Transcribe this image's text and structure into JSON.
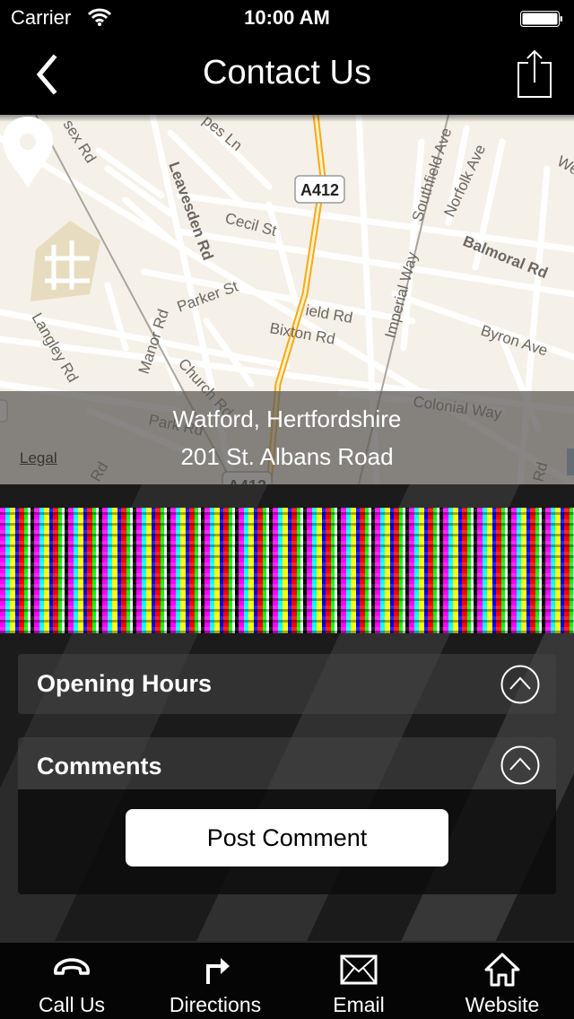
{
  "status_bar": {
    "carrier": "Carrier",
    "time": "10:00 AM"
  },
  "nav": {
    "title": "Contact Us",
    "back_icon": "chevron-left-icon",
    "share_icon": "share-icon"
  },
  "map": {
    "address_line1": "Watford, Hertfordshire",
    "address_line2": "201 St. Albans Road",
    "legal_label": "Legal",
    "road_shield": "A412",
    "street_labels": [
      "sex Rd",
      "pes Ln",
      "Leavesden Rd",
      "Cecil St",
      "Parker St",
      "Southfield Ave",
      "Norfolk Ave",
      "Balmoral Rd",
      "We",
      "Imperial Way",
      "Byron Ave",
      "ield Rd",
      "Bixton Rd",
      "Langley Rd",
      "Manor Rd",
      "Church Rd",
      "Park Rd",
      "Colonial Way",
      "Rd",
      "Rd"
    ]
  },
  "carousel": {
    "description": "image carousel (corrupted render)"
  },
  "sections": [
    {
      "title": "Opening Hours",
      "expanded": false
    },
    {
      "title": "Comments",
      "expanded": true,
      "action_label": "Post Comment"
    }
  ],
  "tabs": [
    {
      "label": "Call Us",
      "icon": "phone-icon"
    },
    {
      "label": "Directions",
      "icon": "directions-arrow-icon"
    },
    {
      "label": "Email",
      "icon": "envelope-icon"
    },
    {
      "label": "Website",
      "icon": "home-icon"
    }
  ],
  "colors": {
    "bar_background": "#000000",
    "map_land": "#f5f1e8",
    "map_road": "#ffffff",
    "map_major_road": "#f6a81c",
    "map_park": "#e8dcc0",
    "overlay": "#5a5854",
    "text_primary": "#ffffff"
  }
}
